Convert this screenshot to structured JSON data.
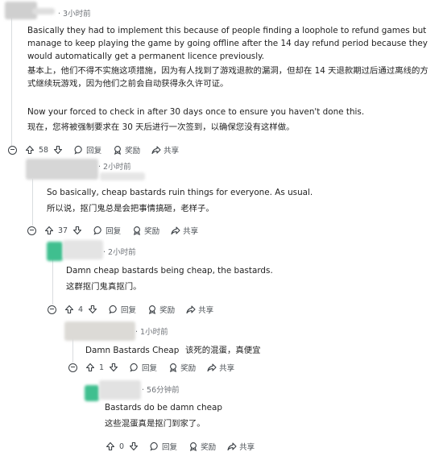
{
  "comments": [
    {
      "time": "· 3小时前",
      "text_en": "Basically they had to implement this because of people finding a loophole to refund games but manage to keep playing the game by going offline after the 14 day refund period because they would automatically get a permanent licence previously.",
      "text_zh": "基本上，他们不得不实施这项措施，因为有人找到了游戏退款的漏洞，但却在 14 天退款期过后通过离线的方式继续玩游戏，因为他们之前会自动获得永久许可证。",
      "text_en2": "Now your forced to check in after 30 days once to ensure you haven't done this.",
      "text_zh2": "现在，您将被强制要求在 30 天后进行一次签到，以确保您没有这样做。",
      "votes": "58"
    },
    {
      "time": "· 2小时前",
      "text_en": "So basically, cheap bastards ruin things for everyone. As usual.",
      "text_zh": "所以说，抠门鬼总是会把事情搞砸，老样子。",
      "votes": "37"
    },
    {
      "time": "· 2小时前",
      "text_en": "Damn cheap bastards being cheap, the bastards.",
      "text_zh": "这群抠门鬼真抠门。",
      "votes": "4"
    },
    {
      "time": "· 1小时前",
      "text_en": "Damn Bastards Cheap",
      "text_zh": "该死的混蛋，真便宜",
      "votes": "1"
    },
    {
      "time": "· 56分钟前",
      "text_en": "Bastards do be damn cheap",
      "text_zh": "这些混蛋真是抠门到家了。",
      "votes": "0"
    }
  ],
  "actions": {
    "reply": "回复",
    "award": "奖励",
    "share": "共享"
  },
  "colors": {
    "avatar_green": "#3fbf8f",
    "meta": "#6f7378",
    "thread": "#d9dcdf"
  }
}
